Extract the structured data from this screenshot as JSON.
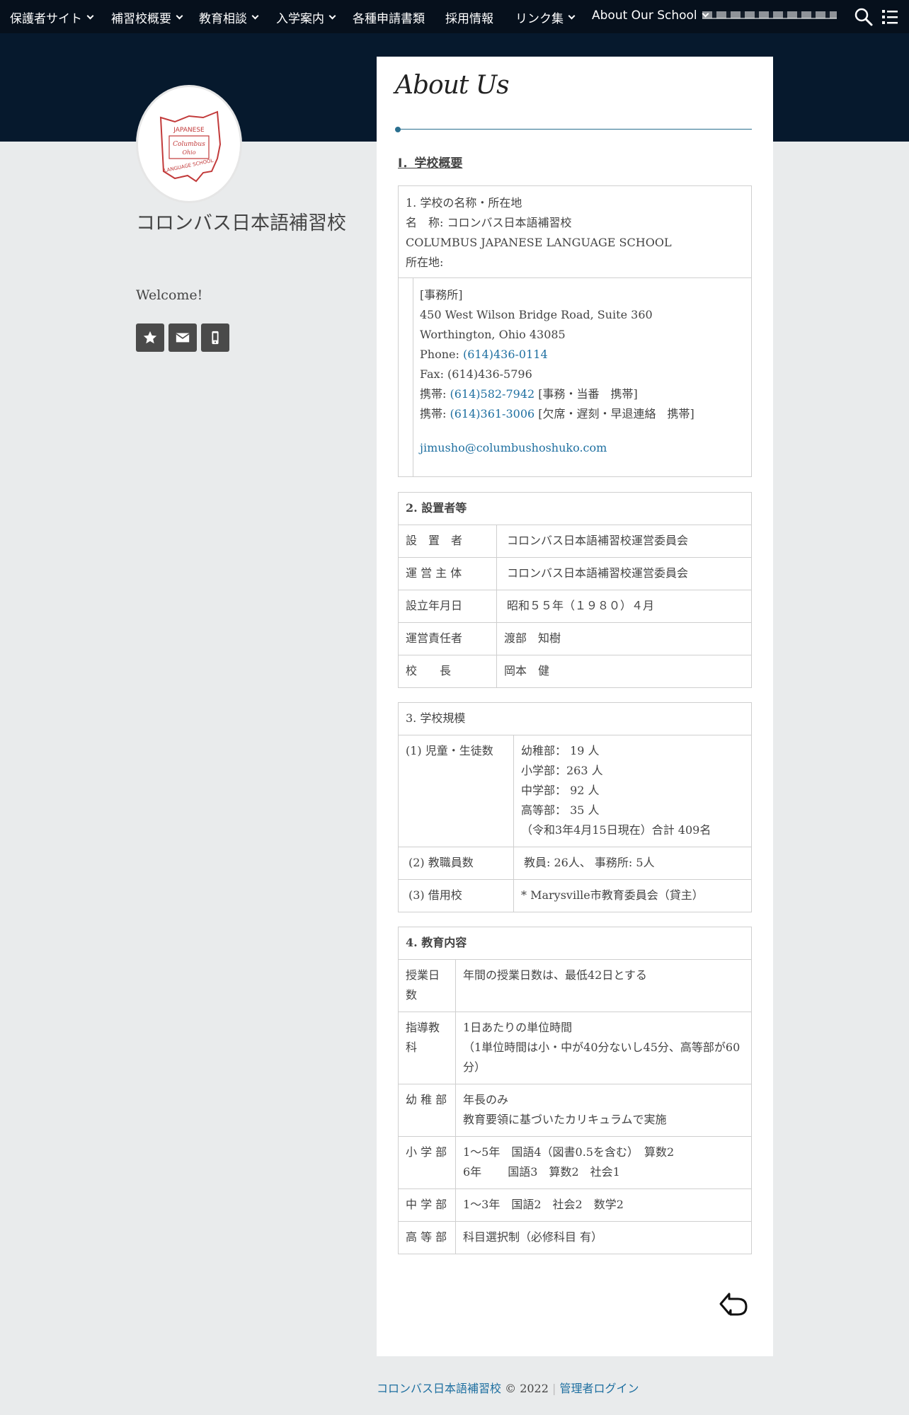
{
  "nav": {
    "items": [
      {
        "label": "保護者サイト",
        "dropdown": true
      },
      {
        "label": "補習校概要",
        "dropdown": true
      },
      {
        "label": "教育相談",
        "dropdown": true
      },
      {
        "label": "入学案内",
        "dropdown": true
      },
      {
        "label": "各種申請書類",
        "dropdown": false
      },
      {
        "label": "採用情報",
        "dropdown": false
      },
      {
        "label": "リンク集",
        "dropdown": true
      },
      {
        "label": "About Our School",
        "dropdown": true
      }
    ],
    "search_icon": "search-icon",
    "menu_icon": "menu-icon"
  },
  "sidebar": {
    "logo_text": {
      "top": "JAPANESE",
      "script1": "Columbus",
      "script2": "Ohio",
      "bottom": "LANGUAGE SCHOOL"
    },
    "site_title": "コロンバス日本語補習校",
    "welcome": "Welcome!",
    "social": [
      "star-icon",
      "mail-icon",
      "mobile-icon"
    ]
  },
  "main": {
    "title": "About Us",
    "section_heading": "Ⅰ．学校概要",
    "s1": {
      "lines": [
        "1. 学校の名称・所在地",
        "名　称:  コロンバス日本語補習校",
        "COLUMBUS JAPANESE LANGUAGE SCHOOL",
        "所在地:"
      ],
      "office_label": "[事務所]",
      "address1": "450 West Wilson Bridge Road, Suite 360",
      "address2": "Worthington, Ohio 43085",
      "phone_label": "Phone: ",
      "phone": "(614)436-0114",
      "fax": "Fax:  (614)436-5796",
      "mobile1_label": "携帯: ",
      "mobile1": "(614)582-7942",
      "mobile1_note": " [事務・当番　携帯]",
      "mobile2_label": "携帯: ",
      "mobile2": "(614)361-3006",
      "mobile2_note": " [欠席・遅刻・早退連絡　携帯]",
      "email": "jimusho@columbushoshuko.com"
    },
    "s2": {
      "header": "2. 設置者等",
      "rows": [
        {
          "k": "設　置　者",
          "v": "コロンバス日本語補習校運営委員会"
        },
        {
          "k": "運 営 主 体",
          "v": "コロンバス日本語補習校運営委員会"
        },
        {
          "k": "設立年月日",
          "v": "昭和５５年（１９８０）４月"
        },
        {
          "k": "運営責任者",
          "v": "渡部　知樹"
        },
        {
          "k": "校　　長",
          "v": "岡本　健"
        }
      ]
    },
    "s3": {
      "header": "3. 学校規模",
      "r1_label": "(1) 児童・生徒数",
      "r1_lines": [
        "幼稚部：  19 人",
        "小学部：263 人",
        "中学部：  92 人",
        "高等部：  35 人",
        "（令和3年4月15日現在）合計 409名"
      ],
      "r2_label": "(2) 教職員数",
      "r2_value": "教員:  26人、   事務所:  5人",
      "r3_label": "(3) 借用校",
      "r3_value": "* Marysville市教育委員会（貸主）"
    },
    "s4": {
      "header": "4. 教育内容",
      "rows": [
        {
          "k": "授業日数",
          "v": [
            "年間の授業日数は、最低42日とする"
          ]
        },
        {
          "k": "指導教科",
          "v": [
            "1日あたりの単位時間",
            "（1単位時間は小・中が40分ないし45分、高等部が60分）"
          ]
        },
        {
          "k": "幼 稚 部",
          "v": [
            "年長のみ",
            "教育要領に基づいたカリキュラムで実施"
          ]
        },
        {
          "k": "小 学 部",
          "v": [
            "1～5年　国語4（図書0.5を含む）　算数2",
            "6年　　 国語3　算数2　社会1"
          ]
        },
        {
          "k": "中 学 部",
          "v": [
            "1～3年　国語2　社会2　数学2"
          ]
        },
        {
          "k": "高 等 部",
          "v": [
            "科目選択制（必修科目 有）"
          ]
        }
      ]
    },
    "back_icon": "return-arrow-icon"
  },
  "footer": {
    "site_link": "コロンバス日本語補習校",
    "copyright": " © 2022 ",
    "separator": "|",
    "admin_link": "管理者ログイン"
  }
}
